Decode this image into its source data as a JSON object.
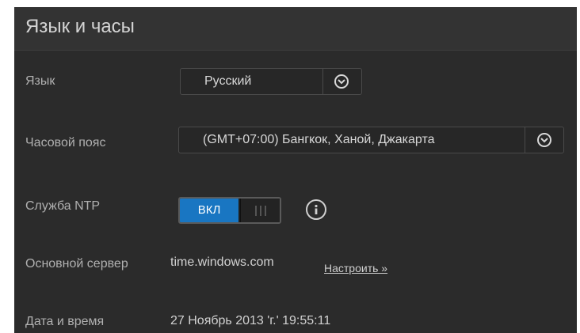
{
  "header": {
    "title": "Язык и часы"
  },
  "language": {
    "label": "Язык",
    "value": "Русский",
    "icon": "chevron-down-icon"
  },
  "timezone": {
    "label": "Часовой пояс",
    "value": "(GMT+07:00) Бангкок, Ханой, Джакарта",
    "icon": "chevron-down-icon"
  },
  "ntp": {
    "label": "Служба NTP",
    "toggle_on_label": "ВКЛ",
    "state": "on",
    "info_icon": "info-icon"
  },
  "server": {
    "label": "Основной сервер",
    "value": "time.windows.com",
    "link": "Настроить »"
  },
  "datetime": {
    "label": "Дата и время",
    "value": "27 Ноябрь 2013 'г.' 19:55:11"
  },
  "colors": {
    "panel_bg": "#2b2b2b",
    "accent": "#1976c2",
    "text": "#d2d2d2"
  }
}
